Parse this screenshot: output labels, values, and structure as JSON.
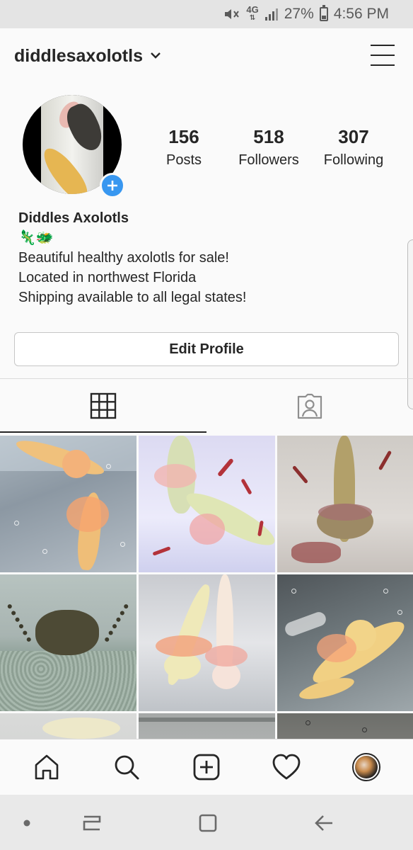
{
  "status_bar": {
    "network": "4G",
    "battery": "27%",
    "time": "4:56 PM"
  },
  "header": {
    "username": "diddlesaxolotls"
  },
  "profile": {
    "stats": [
      {
        "value": "156",
        "label": "Posts"
      },
      {
        "value": "518",
        "label": "Followers"
      },
      {
        "value": "307",
        "label": "Following"
      }
    ],
    "name": "Diddles Axolotls",
    "emoji": "🦎🐲",
    "bio_lines": [
      "Beautiful healthy axolotls for sale!",
      "Located in northwest Florida",
      "Shipping available to all legal states!"
    ],
    "edit_button": "Edit Profile"
  },
  "tabs": [
    {
      "icon": "grid-icon",
      "active": true
    },
    {
      "icon": "tagged-photos-icon",
      "active": false
    }
  ],
  "posts": [
    {
      "subject": "two golden axolotls in tank"
    },
    {
      "subject": "two pale axolotls with bloodworms"
    },
    {
      "subject": "olive axolotl with bloodworms"
    },
    {
      "subject": "dark wild-type axolotl over gravel"
    },
    {
      "subject": "two pink-gilled leucistic axolotls"
    },
    {
      "subject": "golden axolotl in clear tank"
    },
    {
      "subject": "partial post"
    },
    {
      "subject": "partial post"
    },
    {
      "subject": "partial post"
    }
  ],
  "bottom_nav": [
    {
      "icon": "home-icon"
    },
    {
      "icon": "search-icon"
    },
    {
      "icon": "new-post-icon"
    },
    {
      "icon": "activity-heart-icon"
    },
    {
      "icon": "profile-avatar-icon"
    }
  ],
  "colors": {
    "accent_blue": "#3897f0",
    "text": "#262626",
    "background": "#fafafa"
  }
}
